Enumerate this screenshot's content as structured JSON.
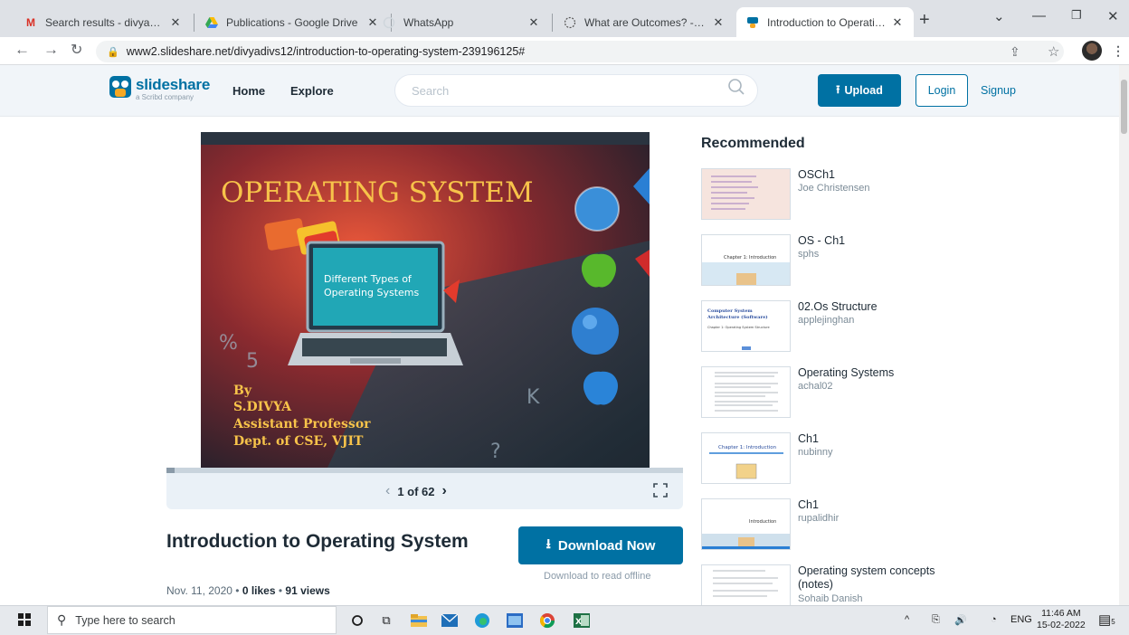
{
  "browser": {
    "tabs": [
      {
        "title": "Search results - divyas@vjit.a",
        "icon": "gmail-icon"
      },
      {
        "title": "Publications - Google Drive",
        "icon": "drive-icon"
      },
      {
        "title": "WhatsApp",
        "icon": "whatsapp-icon"
      },
      {
        "title": "What are Outcomes? - Instru",
        "icon": "instructure-icon"
      },
      {
        "title": "Introduction to Operating Sy",
        "icon": "slideshare-icon"
      }
    ],
    "url": "www2.slideshare.net/divyadivs12/introduction-to-operating-system-239196125#"
  },
  "header": {
    "logo": "slideshare",
    "logo_sub": "a Scribd company",
    "nav": [
      "Home",
      "Explore"
    ],
    "search_placeholder": "Search",
    "upload": "Upload",
    "login": "Login",
    "signup": "Signup"
  },
  "slide": {
    "heading": "OPERATING SYSTEM",
    "screen_text_1": "Different Types of",
    "screen_text_2": "Operating Systems",
    "author_by": "By",
    "author_name": "S.DIVYA",
    "author_role": "Assistant Professor",
    "author_dept": "Dept. of CSE, VJIT",
    "progress_fraction": 0.016
  },
  "pager": {
    "label": "1 of 62"
  },
  "document": {
    "title": "Introduction to Operating System",
    "date": "Nov. 11, 2020",
    "likes": "0 likes",
    "views": "91 views",
    "download_label": "Download Now",
    "download_sub": "Download to read offline"
  },
  "recommended": {
    "heading": "Recommended",
    "items": [
      {
        "title": "OSCh1",
        "author": "Joe Christensen"
      },
      {
        "title": "OS - Ch1",
        "author": "sphs"
      },
      {
        "title": "02.Os Structure",
        "author": "applejinghan"
      },
      {
        "title": "Operating Systems",
        "author": "achal02"
      },
      {
        "title": "Ch1",
        "author": "nubinny"
      },
      {
        "title": "Ch1",
        "author": "rupalidhir"
      },
      {
        "title": "Operating system concepts (notes)",
        "author": "Sohaib Danish"
      }
    ],
    "thumb_texts": {
      "t2": "Chapter 1: Introduction",
      "t3a": "Computer System",
      "t3b": "Architecture (Software)",
      "t3c": "Chapter 1: Operating System Structure",
      "t5": "Chapter 1: Introduction",
      "t6": "Introduction"
    }
  },
  "taskbar": {
    "search_placeholder": "Type here to search",
    "lang": "ENG",
    "time": "11:46 AM",
    "date": "15-02-2022",
    "notifications": "5"
  },
  "colors": {
    "accent": "#0071a3",
    "header_bg": "#f1f5f9",
    "slide_title": "#f7c34a"
  }
}
